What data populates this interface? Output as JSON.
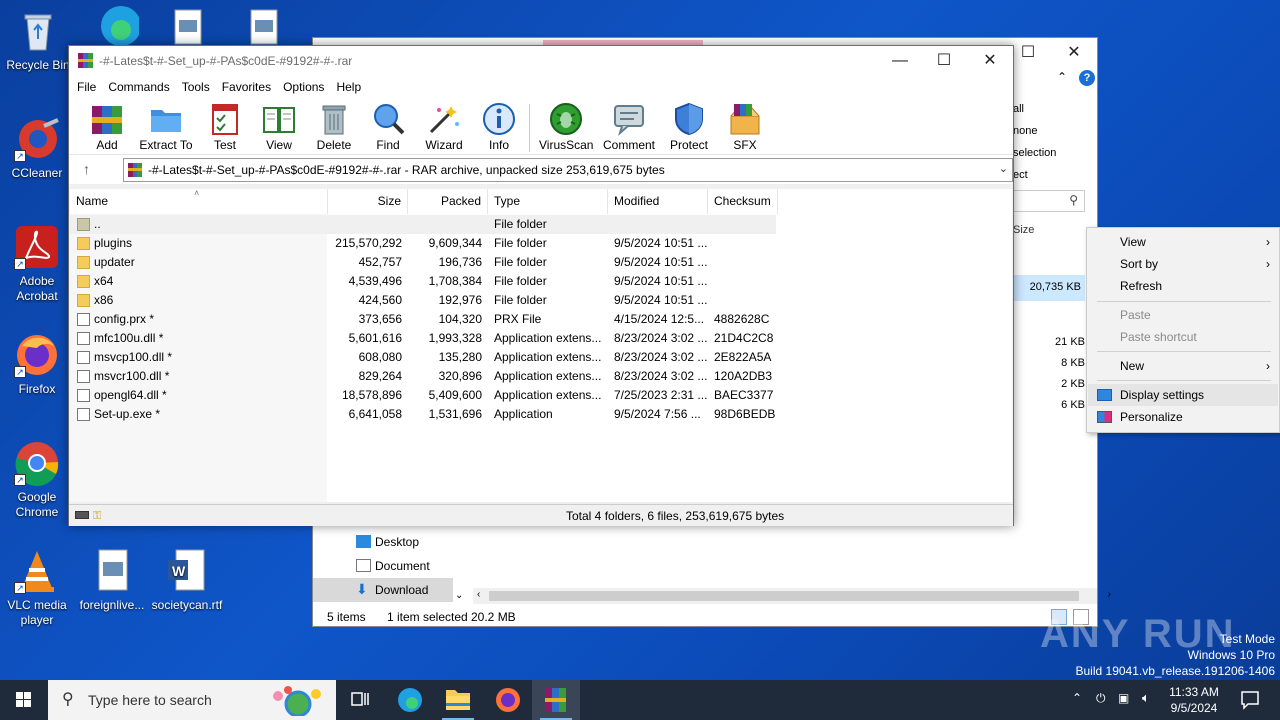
{
  "desktop": {
    "icons": [
      {
        "label": "Recycle Bin"
      },
      {
        "label": "CCleaner"
      },
      {
        "label": "Adobe Acrobat"
      },
      {
        "label": "Firefox"
      },
      {
        "label": "Google Chrome"
      },
      {
        "label": "VLC media player"
      },
      {
        "label": "foreignlive..."
      },
      {
        "label": "societycan.rtf"
      }
    ]
  },
  "explorer": {
    "right_panel": [
      "all",
      "none",
      "selection",
      "ect"
    ],
    "size_header": "Size",
    "selected_size": "20,735 KB",
    "sizes": [
      "21 KB",
      "8 KB",
      "2 KB",
      "6 KB"
    ],
    "nav": [
      {
        "label": "Desktop"
      },
      {
        "label": "Document"
      },
      {
        "label": "Download"
      }
    ],
    "status_items": "5 items",
    "status_selected": "1 item selected",
    "status_size": "20.2 MB"
  },
  "winrar": {
    "title": "-#-Lates$t-#-Set_up-#-PAs$c0dE-#9192#-#-.rar",
    "menu": [
      "File",
      "Commands",
      "Tools",
      "Favorites",
      "Options",
      "Help"
    ],
    "toolbar": [
      {
        "label": "Add",
        "icon": "add-icon"
      },
      {
        "label": "Extract To",
        "icon": "extract-icon"
      },
      {
        "label": "Test",
        "icon": "test-icon"
      },
      {
        "label": "View",
        "icon": "view-icon"
      },
      {
        "label": "Delete",
        "icon": "delete-icon"
      },
      {
        "label": "Find",
        "icon": "find-icon"
      },
      {
        "label": "Wizard",
        "icon": "wizard-icon"
      },
      {
        "label": "Info",
        "icon": "info-icon"
      },
      {
        "label": "VirusScan",
        "icon": "virusscan-icon"
      },
      {
        "label": "Comment",
        "icon": "comment-icon"
      },
      {
        "label": "Protect",
        "icon": "protect-icon"
      },
      {
        "label": "SFX",
        "icon": "sfx-icon"
      }
    ],
    "address": "-#-Lates$t-#-Set_up-#-PAs$c0dE-#9192#-#-.rar - RAR archive, unpacked size 253,619,675 bytes",
    "columns": [
      "Name",
      "Size",
      "Packed",
      "Type",
      "Modified",
      "Checksum"
    ],
    "rows": [
      {
        "name": "..",
        "size": "",
        "packed": "",
        "type": "File folder",
        "modified": "",
        "checksum": "",
        "kind": "folder"
      },
      {
        "name": "plugins",
        "size": "215,570,292",
        "packed": "9,609,344",
        "type": "File folder",
        "modified": "9/5/2024 10:51 ...",
        "checksum": "",
        "kind": "folder"
      },
      {
        "name": "updater",
        "size": "452,757",
        "packed": "196,736",
        "type": "File folder",
        "modified": "9/5/2024 10:51 ...",
        "checksum": "",
        "kind": "folder"
      },
      {
        "name": "x64",
        "size": "4,539,496",
        "packed": "1,708,384",
        "type": "File folder",
        "modified": "9/5/2024 10:51 ...",
        "checksum": "",
        "kind": "folder"
      },
      {
        "name": "x86",
        "size": "424,560",
        "packed": "192,976",
        "type": "File folder",
        "modified": "9/5/2024 10:51 ...",
        "checksum": "",
        "kind": "folder"
      },
      {
        "name": "config.prx *",
        "size": "373,656",
        "packed": "104,320",
        "type": "PRX File",
        "modified": "4/15/2024 12:5...",
        "checksum": "4882628C",
        "kind": "file"
      },
      {
        "name": "mfc100u.dll *",
        "size": "5,601,616",
        "packed": "1,993,328",
        "type": "Application extens...",
        "modified": "8/23/2024 3:02 ...",
        "checksum": "21D4C2C8",
        "kind": "file"
      },
      {
        "name": "msvcp100.dll *",
        "size": "608,080",
        "packed": "135,280",
        "type": "Application extens...",
        "modified": "8/23/2024 3:02 ...",
        "checksum": "2E822A5A",
        "kind": "file"
      },
      {
        "name": "msvcr100.dll *",
        "size": "829,264",
        "packed": "320,896",
        "type": "Application extens...",
        "modified": "8/23/2024 3:02 ...",
        "checksum": "120A2DB3",
        "kind": "file"
      },
      {
        "name": "opengl64.dll *",
        "size": "18,578,896",
        "packed": "5,409,600",
        "type": "Application extens...",
        "modified": "7/25/2023 2:31 ...",
        "checksum": "BAEC3377",
        "kind": "file"
      },
      {
        "name": "Set-up.exe *",
        "size": "6,641,058",
        "packed": "1,531,696",
        "type": "Application",
        "modified": "9/5/2024 7:56 ...",
        "checksum": "98D6BEDB",
        "kind": "file"
      }
    ],
    "status": "Total 4 folders, 6 files, 253,619,675 bytes"
  },
  "context_menu": {
    "items": [
      {
        "label": "View",
        "submenu": true,
        "disabled": false
      },
      {
        "label": "Sort by",
        "submenu": true,
        "disabled": false
      },
      {
        "label": "Refresh",
        "submenu": false,
        "disabled": false
      },
      {
        "label": "Paste",
        "submenu": false,
        "disabled": true
      },
      {
        "label": "Paste shortcut",
        "submenu": false,
        "disabled": true
      },
      {
        "label": "New",
        "submenu": true,
        "disabled": false
      },
      {
        "label": "Display settings",
        "submenu": false,
        "disabled": false
      },
      {
        "label": "Personalize",
        "submenu": false,
        "disabled": false
      }
    ]
  },
  "taskbar": {
    "search_placeholder": "Type here to search",
    "time": "11:33 AM",
    "date": "9/5/2024"
  },
  "watermark": {
    "line1": "Test Mode",
    "line2": "Windows 10 Pro",
    "line3": "Build 19041.vb_release.191206-1406",
    "brand": "ANY RUN"
  },
  "colors": {
    "desktop": "#0f56c9",
    "taskbar": "#1f2a3a",
    "selection": "#cce8ff",
    "folder": "#f5cb5c"
  }
}
